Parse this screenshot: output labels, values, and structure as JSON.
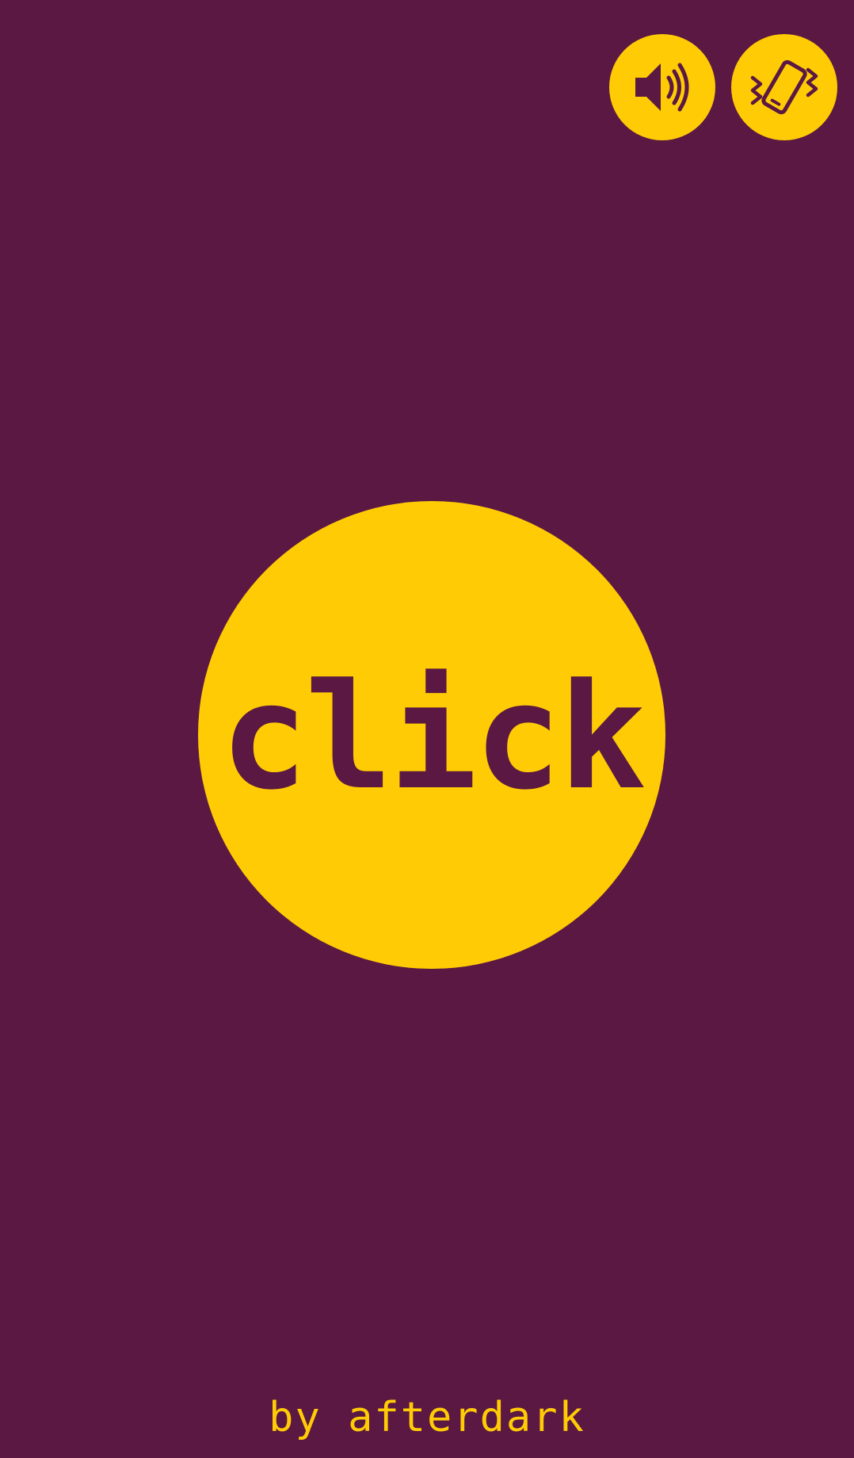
{
  "colors": {
    "background": "#5a1842",
    "accent": "#ffcb05"
  },
  "toolbar": {
    "sound_icon": "speaker-volume-icon",
    "vibrate_icon": "phone-vibrate-icon"
  },
  "main": {
    "button_label": "click"
  },
  "footer": {
    "credit": "by afterdark"
  }
}
